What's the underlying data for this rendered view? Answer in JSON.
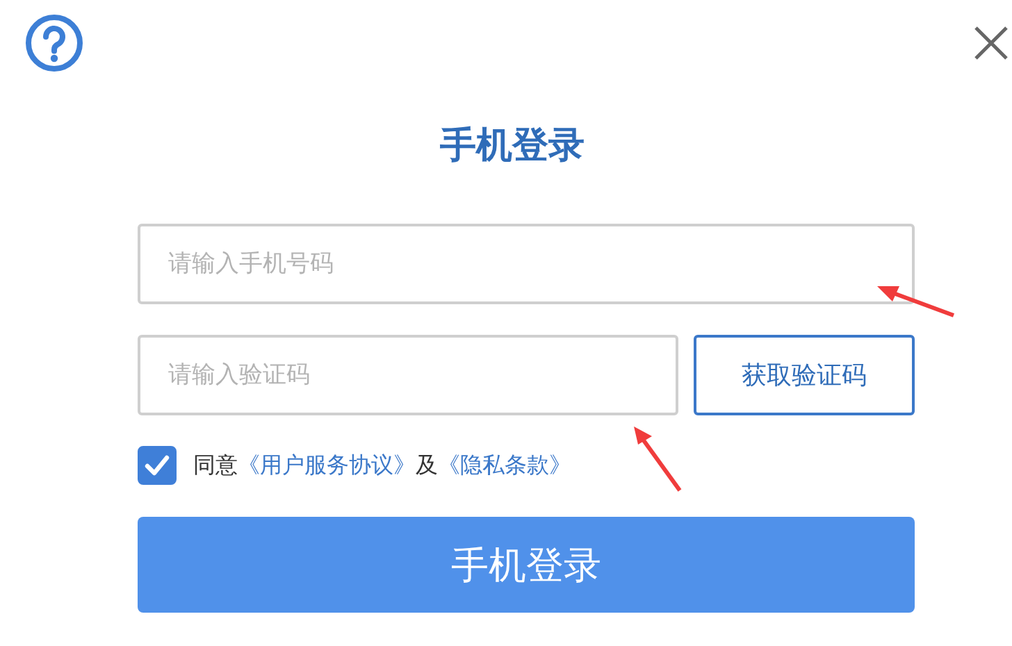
{
  "title": "手机登录",
  "phone_field": {
    "placeholder": "请输入手机号码"
  },
  "code_field": {
    "placeholder": "请输入验证码"
  },
  "get_code_button": "获取验证码",
  "agreement": {
    "checked": true,
    "parts": [
      {
        "kind": "text",
        "text": "同意"
      },
      {
        "kind": "link",
        "text": "《用户服务协议》"
      },
      {
        "kind": "text",
        "text": "及"
      },
      {
        "kind": "link",
        "text": "《隐私条款》"
      }
    ]
  },
  "login_button": "手机登录"
}
